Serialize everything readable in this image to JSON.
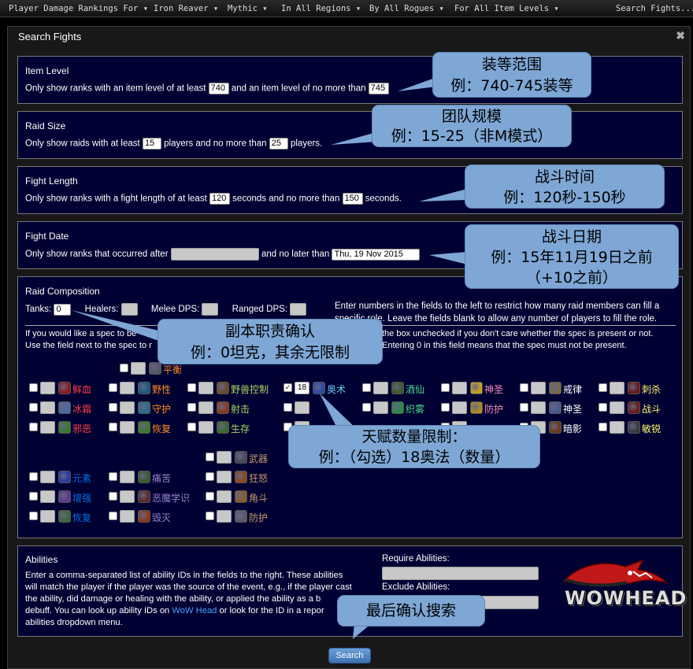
{
  "topnav": {
    "items": [
      "Player Damage Rankings For",
      "Iron Reaver",
      "Mythic",
      "In All Regions",
      "By All Rogues",
      "For All Item Levels"
    ],
    "search_link": "Search Fights..."
  },
  "dialog": {
    "title": "Search Fights",
    "close": "✖"
  },
  "item_level": {
    "title": "Item Level",
    "prefix": "Only show ranks with an item level of at least",
    "min": "740",
    "middle": "and an item level of no more than",
    "max": "745"
  },
  "raid_size": {
    "title": "Raid Size",
    "prefix": "Only show raids with at least",
    "min": "15",
    "middle": "players and no more than",
    "max": "25",
    "suffix": "players."
  },
  "fight_length": {
    "title": "Fight Length",
    "prefix": "Only show ranks with a fight length of at least",
    "min": "120",
    "middle": "seconds and no more than",
    "max": "150",
    "suffix": "seconds."
  },
  "fight_date": {
    "title": "Fight Date",
    "prefix": "Only show ranks that occurred after",
    "after": "",
    "middle": "and no later than",
    "before": "Thu, 19 Nov 2015"
  },
  "raid_comp": {
    "title": "Raid Composition",
    "tanks_label": "Tanks:",
    "tanks_value": "0",
    "healers_label": "Healers:",
    "melee_label": "Melee DPS:",
    "ranged_label": "Ranged DPS:",
    "help1a": "Enter numbers in the fields to the left to restrict how many raid members can fill a",
    "help1b": "specific role. Leave the fields blank to allow any number of players to fill the role.",
    "help2a_left": "If you would like a spec to be",
    "help2a_right": "the box unchecked if you don't care whether the spec is present or not.",
    "help2b_left": "Use the field next to the spec to r",
    "help2b_right": "Entering 0 in this field means that the spec must not be present."
  },
  "specs": [
    {
      "label": "平衡",
      "color": "#ff8c1a",
      "icon": "#556"
    },
    {
      "label": "鲜血",
      "color": "#ff4040",
      "icon": "#8a1a1a"
    },
    {
      "label": "野性",
      "color": "#ff8c1a",
      "icon": "#1a5a7a"
    },
    {
      "label": "野兽控制",
      "color": "#a8d860",
      "icon": "#6a4a2a"
    },
    {
      "label": "18",
      "color": "#000",
      "icon": "#000"
    },
    {
      "label": "奥术",
      "color": "#69ccf0",
      "icon": "#2a4aa0"
    },
    {
      "label": "酒仙",
      "color": "#4cd98a",
      "icon": "#3a5a2a"
    },
    {
      "label": "神圣",
      "color": "#f58cba",
      "icon": "#c8a020"
    },
    {
      "label": "戒律",
      "color": "#ffffff",
      "icon": "#7a6a4a"
    },
    {
      "label": "刺杀",
      "color": "#fff569",
      "icon": "#6a1a1a"
    },
    {
      "label": "冰霜",
      "color": "#ff4040",
      "icon": "#4a6aa0"
    },
    {
      "label": "守护",
      "color": "#ff8c1a",
      "icon": "#2a6a8a"
    },
    {
      "label": "射击",
      "color": "#a8d860",
      "icon": "#8a3a1a"
    },
    {
      "label": "织雾",
      "color": "#4cd98a",
      "icon": "#2a8a4a"
    },
    {
      "label": "防护",
      "color": "#f58cba",
      "icon": "#b08a20"
    },
    {
      "label": "神圣",
      "color": "#ffffff",
      "icon": "#4a5a8a"
    },
    {
      "label": "战斗",
      "color": "#fff569",
      "icon": "#6a1a1a"
    },
    {
      "label": "邪恶",
      "color": "#ff4040",
      "icon": "#3a7a2a"
    },
    {
      "label": "恢复",
      "color": "#ff8c1a",
      "icon": "#3a7a2a"
    },
    {
      "label": "生存",
      "color": "#a8d860",
      "icon": "#3a6a2a"
    },
    {
      "label": "暗影",
      "color": "#ffffff",
      "icon": "#6a3a1a"
    },
    {
      "label": "敏锐",
      "color": "#fff569",
      "icon": "#3a3a3a"
    },
    {
      "label": "武器",
      "color": "#c79c6e",
      "icon": "#4a4a5a"
    },
    {
      "label": "元素",
      "color": "#0070de",
      "icon": "#2a3aa0"
    },
    {
      "label": "痛苦",
      "color": "#9482c9",
      "icon": "#3a5a2a"
    },
    {
      "label": "狂怒",
      "color": "#c79c6e",
      "icon": "#8a4a1a"
    },
    {
      "label": "增强",
      "color": "#0070de",
      "icon": "#5a3a8a"
    },
    {
      "label": "恶魔学识",
      "color": "#9482c9",
      "icon": "#5a2a2a"
    },
    {
      "label": "角斗",
      "color": "#c79c6e",
      "icon": "#8a5a2a"
    },
    {
      "label": "恢复",
      "color": "#0070de",
      "icon": "#3a6a3a"
    },
    {
      "label": "毁灭",
      "color": "#9482c9",
      "icon": "#8a3a1a"
    },
    {
      "label": "防护",
      "color": "#c79c6e",
      "icon": "#5a5a6a"
    }
  ],
  "abilities": {
    "title": "Abilities",
    "line1": "Enter a comma-separated list of ability IDs in the fields to the right. These abilities",
    "line2": "will match the player if the player was the source of the event, e.g., if the player cast",
    "line3": "the ability, did damage or healing with the ability, or applied the ability as a b",
    "line4": "debuff. You can look up ability IDs on",
    "wowhead_link": "WoW Head",
    "line4b": "or look for the ID in a repor",
    "line5": "abilities dropdown menu.",
    "require_label": "Require Abilities:",
    "exclude_label": "Exclude Abilities:",
    "logo_text": "WOWHEAD"
  },
  "search_button": "Search",
  "callouts": {
    "c1a": "装等范围",
    "c1b": "例：740-745装等",
    "c2a": "团队规模",
    "c2b": "例：15-25（非M模式）",
    "c3a": "战斗时间",
    "c3b": "例：120秒-150秒",
    "c4a": "战斗日期",
    "c4b": "例：15年11月19日之前",
    "c4c": "（+10之前）",
    "c5a": "副本职责确认",
    "c5b": "例：0坦克，其余无限制",
    "c6a": "天赋数量限制：",
    "c6b": "例：（勾选）18奥法（数量）",
    "c7": "最后确认搜索"
  }
}
